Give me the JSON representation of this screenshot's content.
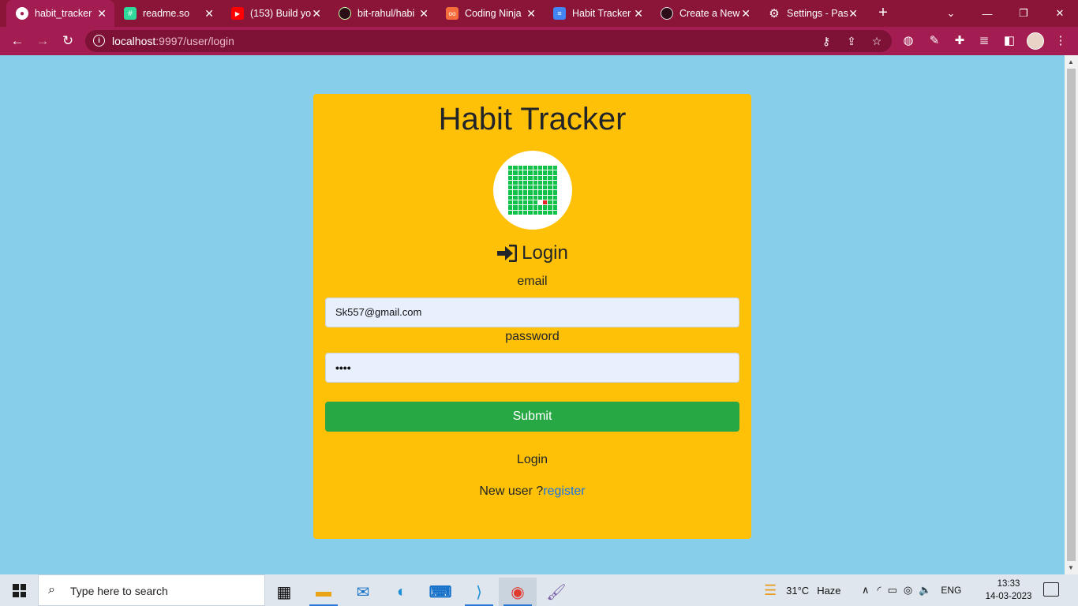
{
  "browser": {
    "tabs": [
      {
        "title": "habit_tracker",
        "active": true,
        "favicon": "globe-icon"
      },
      {
        "title": "readme.so",
        "active": false,
        "favicon": "readme-icon"
      },
      {
        "title": "(153) Build yo",
        "active": false,
        "favicon": "youtube-icon"
      },
      {
        "title": "bit-rahul/habi",
        "active": false,
        "favicon": "github-icon"
      },
      {
        "title": "Coding Ninja",
        "active": false,
        "favicon": "codingninjas-icon"
      },
      {
        "title": "Habit Tracker",
        "active": false,
        "favicon": "docs-icon"
      },
      {
        "title": "Create a New",
        "active": false,
        "favicon": "github-icon"
      },
      {
        "title": "Settings - Pas",
        "active": false,
        "favicon": "settings-icon"
      }
    ],
    "url_host": "localhost",
    "url_path": ":9997/user/login",
    "colors": {
      "frame": "#8a1538",
      "toolbar": "#a31d52"
    }
  },
  "page": {
    "app_title": "Habit Tracker",
    "login_heading": "Login",
    "email_label": "email",
    "email_value": "Sk557@gmail.com",
    "password_label": "password",
    "password_value": "••••",
    "submit_label": "Submit",
    "login_text": "Login",
    "new_user_text": "New user ?",
    "register_link": "register",
    "colors": {
      "background": "#87ceeb",
      "card": "#ffc107",
      "submit": "#28a745",
      "link": "#1a73e8"
    }
  },
  "taskbar": {
    "search_placeholder": "Type here to search",
    "weather_temp": "31°C",
    "weather_desc": "Haze",
    "language": "ENG",
    "time": "13:33",
    "date": "14-03-2023"
  }
}
